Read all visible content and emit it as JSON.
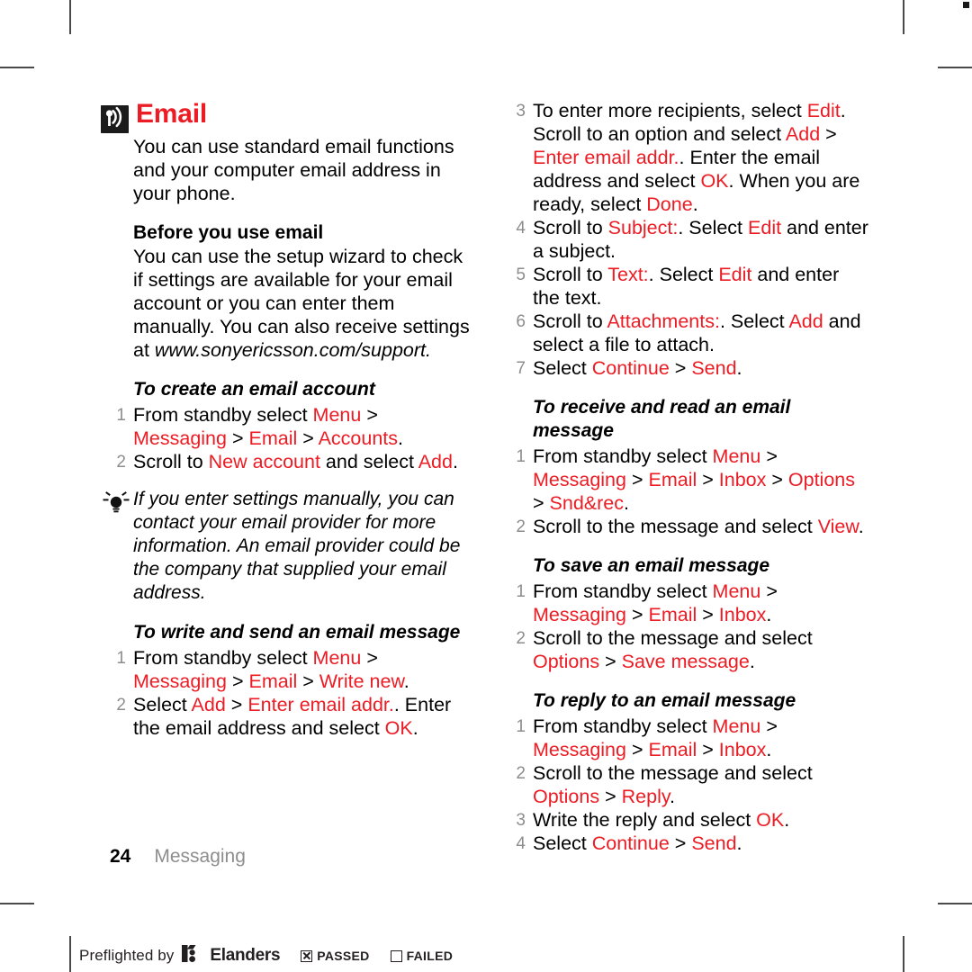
{
  "colors": {
    "accent_red": "#ec1c24",
    "step_number_gray": "#8d8d8d",
    "running_head_gray": "#8d8d8d",
    "icon_dark": "#1b1b1b"
  },
  "chapter": {
    "icon": "wireless-signal-icon",
    "title": "Email",
    "intro": "You can use standard email functions and your computer email address in your phone."
  },
  "before_you_use": {
    "heading": "Before you use email",
    "body_lead": "You can use the setup wizard to check if settings are available for your email account or you can enter them manually. You can also receive settings at ",
    "url": "www.sonyericsson.com/support.",
    "body_tail": ""
  },
  "left_column": {
    "create_account": {
      "heading": "To create an email account",
      "steps": [
        {
          "parts": [
            {
              "t": "From standby select ",
              "c": "black"
            },
            {
              "t": "Menu",
              "c": "red"
            },
            {
              "t": " > ",
              "c": "black"
            },
            {
              "t": "Messaging",
              "c": "red"
            },
            {
              "t": " > ",
              "c": "black"
            },
            {
              "t": "Email",
              "c": "red"
            },
            {
              "t": " > ",
              "c": "black"
            },
            {
              "t": "Accounts",
              "c": "red"
            },
            {
              "t": ".",
              "c": "black"
            }
          ]
        },
        {
          "parts": [
            {
              "t": "Scroll to ",
              "c": "black"
            },
            {
              "t": "New account",
              "c": "red"
            },
            {
              "t": " and select ",
              "c": "black"
            },
            {
              "t": "Add",
              "c": "red"
            },
            {
              "t": ".",
              "c": "black"
            }
          ]
        }
      ]
    },
    "tip": {
      "icon": "lightbulb-tip-icon",
      "text": "If you enter settings manually, you can contact your email provider for more information. An email provider could be the company that supplied your email address."
    },
    "write_send": {
      "heading": "To write and send an email message",
      "steps": [
        {
          "parts": [
            {
              "t": "From standby select ",
              "c": "black"
            },
            {
              "t": "Menu",
              "c": "red"
            },
            {
              "t": " > ",
              "c": "black"
            },
            {
              "t": "Messaging",
              "c": "red"
            },
            {
              "t": " > ",
              "c": "black"
            },
            {
              "t": "Email",
              "c": "red"
            },
            {
              "t": " > ",
              "c": "black"
            },
            {
              "t": "Write new",
              "c": "red"
            },
            {
              "t": ".",
              "c": "black"
            }
          ]
        },
        {
          "parts": [
            {
              "t": "Select ",
              "c": "black"
            },
            {
              "t": "Add",
              "c": "red"
            },
            {
              "t": " > ",
              "c": "black"
            },
            {
              "t": "Enter email addr.",
              "c": "red"
            },
            {
              "t": ". Enter the email address and select ",
              "c": "black"
            },
            {
              "t": "OK",
              "c": "red"
            },
            {
              "t": ".",
              "c": "black"
            }
          ]
        }
      ]
    }
  },
  "right_column": {
    "write_send_continued": {
      "start_number": 3,
      "steps": [
        {
          "parts": [
            {
              "t": "To enter more recipients, select ",
              "c": "black"
            },
            {
              "t": "Edit",
              "c": "red"
            },
            {
              "t": ". Scroll to an option and select ",
              "c": "black"
            },
            {
              "t": "Add",
              "c": "red"
            },
            {
              "t": " > ",
              "c": "black"
            },
            {
              "t": "Enter email addr.",
              "c": "red"
            },
            {
              "t": ". Enter the email address and select ",
              "c": "black"
            },
            {
              "t": "OK",
              "c": "red"
            },
            {
              "t": ". When you are ready, select ",
              "c": "black"
            },
            {
              "t": "Done",
              "c": "red"
            },
            {
              "t": ".",
              "c": "black"
            }
          ]
        },
        {
          "parts": [
            {
              "t": "Scroll to ",
              "c": "black"
            },
            {
              "t": "Subject:",
              "c": "red"
            },
            {
              "t": ". Select ",
              "c": "black"
            },
            {
              "t": "Edit",
              "c": "red"
            },
            {
              "t": " and enter a subject.",
              "c": "black"
            }
          ]
        },
        {
          "parts": [
            {
              "t": "Scroll to ",
              "c": "black"
            },
            {
              "t": "Text:",
              "c": "red"
            },
            {
              "t": ". Select ",
              "c": "black"
            },
            {
              "t": "Edit",
              "c": "red"
            },
            {
              "t": " and enter the text.",
              "c": "black"
            }
          ]
        },
        {
          "parts": [
            {
              "t": "Scroll to ",
              "c": "black"
            },
            {
              "t": "Attachments:",
              "c": "red"
            },
            {
              "t": ". Select ",
              "c": "black"
            },
            {
              "t": "Add",
              "c": "red"
            },
            {
              "t": " and select a file to attach.",
              "c": "black"
            }
          ]
        },
        {
          "parts": [
            {
              "t": "Select ",
              "c": "black"
            },
            {
              "t": "Continue",
              "c": "red"
            },
            {
              "t": " > ",
              "c": "black"
            },
            {
              "t": "Send",
              "c": "red"
            },
            {
              "t": ".",
              "c": "black"
            }
          ]
        }
      ]
    },
    "receive_read": {
      "heading": "To receive and read an email message",
      "steps": [
        {
          "parts": [
            {
              "t": "From standby select ",
              "c": "black"
            },
            {
              "t": "Menu",
              "c": "red"
            },
            {
              "t": " > ",
              "c": "black"
            },
            {
              "t": "Messaging",
              "c": "red"
            },
            {
              "t": " > ",
              "c": "black"
            },
            {
              "t": "Email",
              "c": "red"
            },
            {
              "t": " > ",
              "c": "black"
            },
            {
              "t": "Inbox",
              "c": "red"
            },
            {
              "t": " > ",
              "c": "black"
            },
            {
              "t": "Options",
              "c": "red"
            },
            {
              "t": " > ",
              "c": "black"
            },
            {
              "t": "Snd&rec",
              "c": "red"
            },
            {
              "t": ".",
              "c": "black"
            }
          ]
        },
        {
          "parts": [
            {
              "t": "Scroll to the message and select ",
              "c": "black"
            },
            {
              "t": "View",
              "c": "red"
            },
            {
              "t": ".",
              "c": "black"
            }
          ]
        }
      ]
    },
    "save_message": {
      "heading": "To save an email message",
      "steps": [
        {
          "parts": [
            {
              "t": "From standby select ",
              "c": "black"
            },
            {
              "t": "Menu",
              "c": "red"
            },
            {
              "t": " > ",
              "c": "black"
            },
            {
              "t": "Messaging",
              "c": "red"
            },
            {
              "t": " > ",
              "c": "black"
            },
            {
              "t": "Email",
              "c": "red"
            },
            {
              "t": " > ",
              "c": "black"
            },
            {
              "t": "Inbox",
              "c": "red"
            },
            {
              "t": ".",
              "c": "black"
            }
          ]
        },
        {
          "parts": [
            {
              "t": "Scroll to the message and select ",
              "c": "black"
            },
            {
              "t": "Options",
              "c": "red"
            },
            {
              "t": " > ",
              "c": "black"
            },
            {
              "t": "Save message",
              "c": "red"
            },
            {
              "t": ".",
              "c": "black"
            }
          ]
        }
      ]
    },
    "reply_message": {
      "heading": "To reply to an email message",
      "steps": [
        {
          "parts": [
            {
              "t": "From standby select ",
              "c": "black"
            },
            {
              "t": "Menu",
              "c": "red"
            },
            {
              "t": " > ",
              "c": "black"
            },
            {
              "t": "Messaging",
              "c": "red"
            },
            {
              "t": " > ",
              "c": "black"
            },
            {
              "t": "Email",
              "c": "red"
            },
            {
              "t": " > ",
              "c": "black"
            },
            {
              "t": "Inbox",
              "c": "red"
            },
            {
              "t": ".",
              "c": "black"
            }
          ]
        },
        {
          "parts": [
            {
              "t": "Scroll to the message and select ",
              "c": "black"
            },
            {
              "t": "Options",
              "c": "red"
            },
            {
              "t": " > ",
              "c": "black"
            },
            {
              "t": "Reply",
              "c": "red"
            },
            {
              "t": ".",
              "c": "black"
            }
          ]
        },
        {
          "parts": [
            {
              "t": "Write the reply and select ",
              "c": "black"
            },
            {
              "t": "OK",
              "c": "red"
            },
            {
              "t": ".",
              "c": "black"
            }
          ]
        },
        {
          "parts": [
            {
              "t": "Select ",
              "c": "black"
            },
            {
              "t": "Continue",
              "c": "red"
            },
            {
              "t": " > ",
              "c": "black"
            },
            {
              "t": "Send",
              "c": "red"
            },
            {
              "t": ".",
              "c": "black"
            }
          ]
        }
      ]
    }
  },
  "footer": {
    "page_number": "24",
    "running_head": "Messaging"
  },
  "preflight": {
    "label": "Preflighted by",
    "brand": "Elanders",
    "passed_label": "PASSED",
    "passed_checked": true,
    "failed_label": "FAILED",
    "failed_checked": false
  }
}
